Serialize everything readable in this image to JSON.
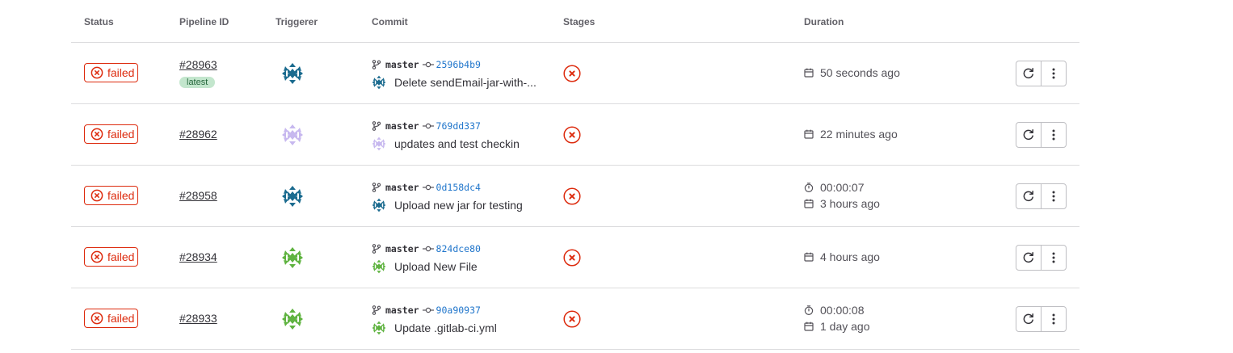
{
  "table": {
    "headers": {
      "status": "Status",
      "pipeline_id": "Pipeline ID",
      "triggerer": "Triggerer",
      "commit": "Commit",
      "stages": "Stages",
      "duration": "Duration"
    },
    "rows": [
      {
        "status": "failed",
        "pipeline_id": "#28963",
        "badge": "latest",
        "branch": "master",
        "sha": "2596b4b9",
        "commit_title": "Delete sendEmail-jar-with-...",
        "avatar_color": "#1b6b8f",
        "duration": "",
        "finished": "50 seconds ago"
      },
      {
        "status": "failed",
        "pipeline_id": "#28962",
        "badge": "",
        "branch": "master",
        "sha": "769dd337",
        "commit_title": "updates and test checkin",
        "avatar_color": "#c7b8ef",
        "duration": "",
        "finished": "22 minutes ago"
      },
      {
        "status": "failed",
        "pipeline_id": "#28958",
        "badge": "",
        "branch": "master",
        "sha": "0d158dc4",
        "commit_title": "Upload new jar for testing",
        "avatar_color": "#1b6b8f",
        "duration": "00:00:07",
        "finished": "3 hours ago"
      },
      {
        "status": "failed",
        "pipeline_id": "#28934",
        "badge": "",
        "branch": "master",
        "sha": "824dce80",
        "commit_title": "Upload New File",
        "avatar_color": "#5fb340",
        "duration": "",
        "finished": "4 hours ago"
      },
      {
        "status": "failed",
        "pipeline_id": "#28933",
        "badge": "",
        "branch": "master",
        "sha": "90a90937",
        "commit_title": "Update .gitlab-ci.yml",
        "avatar_color": "#5fb340",
        "duration": "00:00:08",
        "finished": "1 day ago"
      }
    ]
  },
  "colors": {
    "failed": "#dd2b0e",
    "sha_link": "#1f75cb",
    "border": "#dcdcde",
    "latest_bg": "#c3e6cd",
    "latest_text": "#24663b"
  },
  "icons": {
    "status": "status-failed-icon",
    "branch": "branch-icon",
    "commit": "commit-icon",
    "stage": "stage-failed-icon",
    "duration": "timer-icon",
    "finished": "calendar-icon",
    "retry": "retry-icon",
    "more": "more-vertical-icon"
  }
}
